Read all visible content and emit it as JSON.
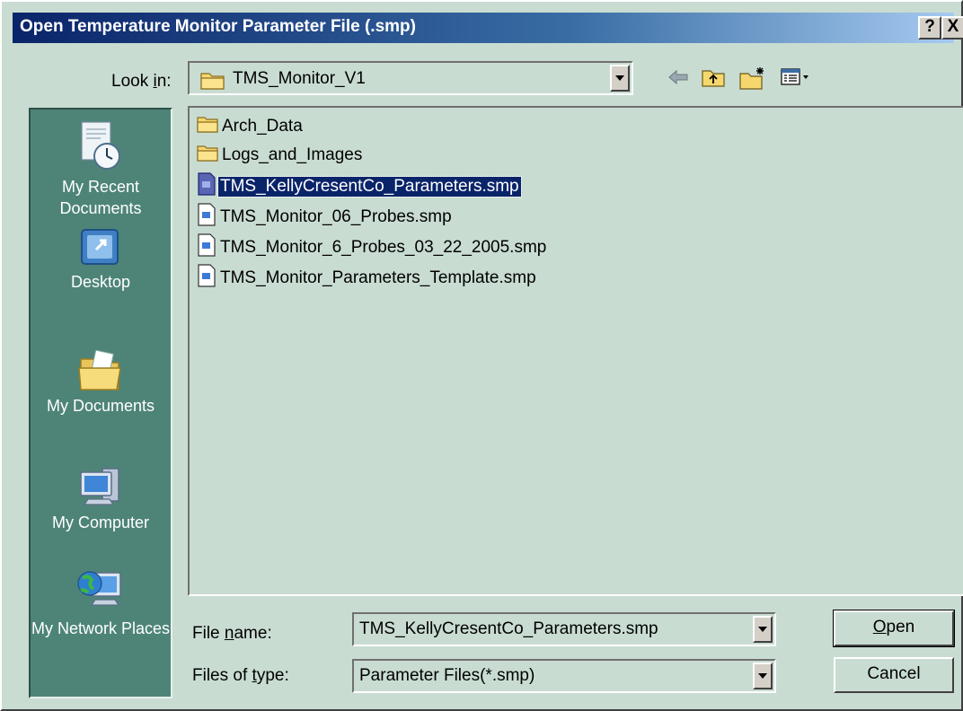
{
  "window": {
    "title": "Open Temperature Monitor Parameter File (.smp)",
    "help_label": "?",
    "close_label": "X"
  },
  "look_in": {
    "label_pre": "Look ",
    "label_ul": "i",
    "label_post": "n:",
    "value": "TMS_Monitor_V1"
  },
  "places": [
    {
      "label": "My Recent Documents",
      "icon": "recent-documents-icon"
    },
    {
      "label": "Desktop",
      "icon": "desktop-icon"
    },
    {
      "label": "My Documents",
      "icon": "my-documents-icon"
    },
    {
      "label": "My Computer",
      "icon": "my-computer-icon"
    },
    {
      "label": "My Network Places",
      "icon": "network-places-icon"
    }
  ],
  "files": [
    {
      "name": "Arch_Data",
      "type": "folder"
    },
    {
      "name": "Logs_and_Images",
      "type": "folder"
    },
    {
      "name": "TMS_KellyCresentCo_Parameters.smp",
      "type": "file",
      "selected": true
    },
    {
      "name": "TMS_Monitor_06_Probes.smp",
      "type": "file"
    },
    {
      "name": "TMS_Monitor_6_Probes_03_22_2005.smp",
      "type": "file"
    },
    {
      "name": "TMS_Monitor_Parameters_Template.smp",
      "type": "file"
    }
  ],
  "file_name": {
    "label_pre": "File ",
    "label_ul": "n",
    "label_post": "ame:",
    "value": "TMS_KellyCresentCo_Parameters.smp"
  },
  "file_type": {
    "label_pre": "Files of ",
    "label_ul": "t",
    "label_post": "ype:",
    "value": "Parameter Files(*.smp)"
  },
  "buttons": {
    "open_ul": "O",
    "open_rest": "pen",
    "cancel": "Cancel"
  },
  "colors": {
    "dialog_bg": "#c9dcd2",
    "places_bg": "#4e8478",
    "title_start": "#0a246a",
    "title_end": "#a6caf0",
    "selection": "#0a246a"
  }
}
